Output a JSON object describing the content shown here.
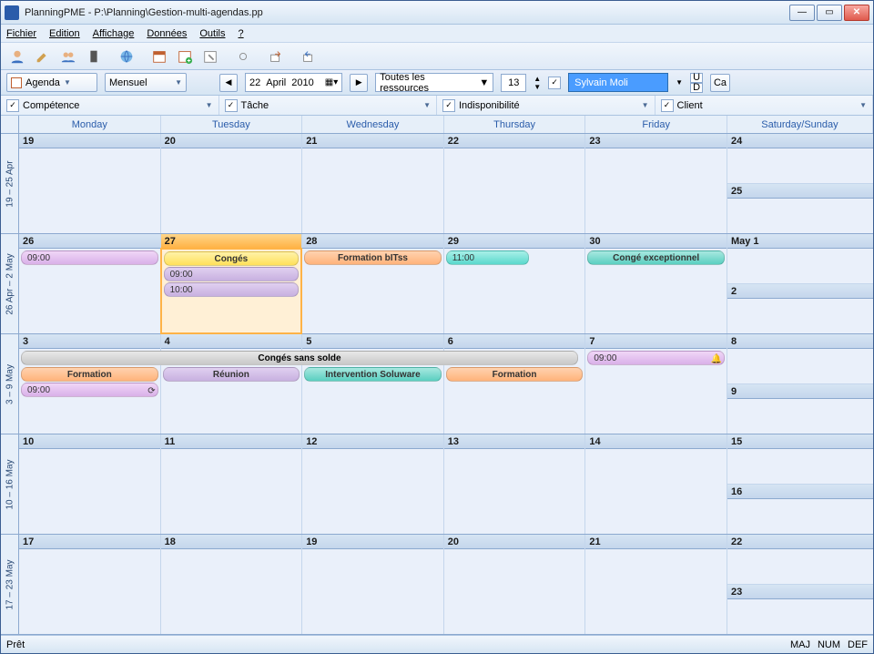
{
  "window": {
    "title": "PlanningPME - P:\\Planning\\Gestion-multi-agendas.pp"
  },
  "menu": {
    "items": [
      "Fichier",
      "Edition",
      "Affichage",
      "Données",
      "Outils",
      "?"
    ]
  },
  "toolbar": {
    "agenda_label": "Agenda",
    "period_label": "Mensuel",
    "date_day": "22",
    "date_month": "April",
    "date_year": "2010",
    "resources_label": "Toutes les ressources",
    "spin_value": "13",
    "user_label": "Sylvain Moli",
    "ud_u": "U",
    "ud_d": "D",
    "ca_label": "Ca"
  },
  "filters": {
    "competence": "Compétence",
    "tache": "Tâche",
    "indispo": "Indisponibilité",
    "client": "Client"
  },
  "day_headers": [
    "Monday",
    "Tuesday",
    "Wednesday",
    "Thursday",
    "Friday",
    "Saturday/Sunday"
  ],
  "weeks": [
    {
      "label": "19 – 25 Apr",
      "days": [
        "19",
        "20",
        "21",
        "22",
        "23"
      ],
      "sat": "24",
      "sun": "25"
    },
    {
      "label": "26 Apr – 2 May",
      "days": [
        "26",
        "27",
        "28",
        "29",
        "30"
      ],
      "sat": "May 1",
      "sun": "2"
    },
    {
      "label": "3 – 9 May",
      "days": [
        "3",
        "4",
        "5",
        "6",
        "7"
      ],
      "sat": "8",
      "sun": "9"
    },
    {
      "label": "10 – 16 May",
      "days": [
        "10",
        "11",
        "12",
        "13",
        "14"
      ],
      "sat": "15",
      "sun": "16"
    },
    {
      "label": "17 – 23 May",
      "days": [
        "17",
        "18",
        "19",
        "20",
        "21"
      ],
      "sat": "22",
      "sun": "23"
    }
  ],
  "events": {
    "w1_mon_0900": "09:00",
    "w1_tue_conges": "Congés",
    "w1_tue_0900": "09:00",
    "w1_tue_1000": "10:00",
    "w1_wed_formation": "Formation  bITss",
    "w1_thu_1100": "11:00",
    "w1_fri_conge_exc": "Congé exceptionnel",
    "w2_span": "Congés sans solde",
    "w2_mon_formation": "Formation",
    "w2_mon_0900": "09:00",
    "w2_tue_reunion": "Réunion",
    "w2_wed_interv": "Intervention  Soluware",
    "w2_thu_formation": "Formation",
    "w2_fri_0900": "09:00"
  },
  "status": {
    "ready": "Prêt",
    "maj": "MAJ",
    "num": "NUM",
    "def": "DEF"
  }
}
